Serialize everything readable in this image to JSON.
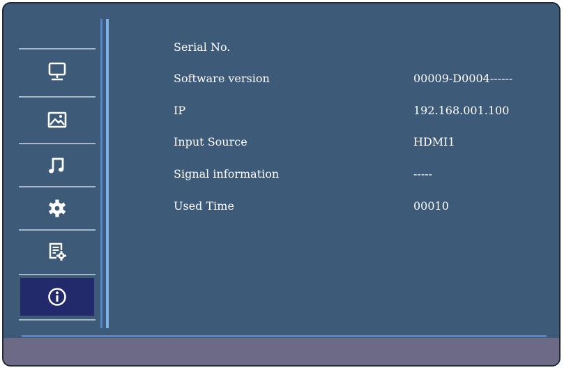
{
  "sidebar": {
    "items": [
      {
        "icon": "monitor-icon"
      },
      {
        "icon": "picture-icon"
      },
      {
        "icon": "music-icon"
      },
      {
        "icon": "gear-icon"
      },
      {
        "icon": "settings-list-icon"
      },
      {
        "icon": "info-icon",
        "active": true
      }
    ]
  },
  "info": {
    "rows": [
      {
        "label": "Serial No.",
        "value": ""
      },
      {
        "label": "Software version",
        "value": "00009-D0004------"
      },
      {
        "label": "IP",
        "value": "192.168.001.100"
      },
      {
        "label": "Input Source",
        "value": "HDMI1"
      },
      {
        "label": "Signal information",
        "value": "-----"
      },
      {
        "label": "Used Time",
        "value": "00010"
      }
    ]
  },
  "colors": {
    "background": "#3d5a78",
    "active_item": "#232a6b",
    "accent_bar": "#7fb2e6",
    "bottom_bar": "#6c6a85",
    "text": "#ffffff"
  }
}
